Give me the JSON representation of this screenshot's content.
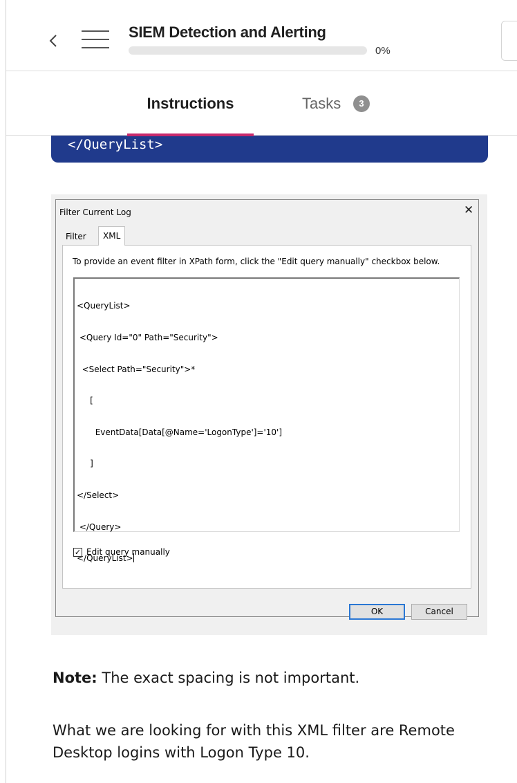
{
  "header": {
    "title": "SIEM Detection and Alerting",
    "progress_percent": 0,
    "progress_label": "0%",
    "accent_color": "#c7296c"
  },
  "tabs": {
    "instructions_label": "Instructions",
    "tasks_label": "Tasks",
    "tasks_count": "3"
  },
  "code_block": {
    "visible_line": "</QueryList>",
    "background": "#203a8c"
  },
  "dialog": {
    "title": "Filter Current Log",
    "close_glyph": "✕",
    "tab_filter": "Filter",
    "tab_xml": "XML",
    "hint": "To provide an event filter in XPath form, click the \"Edit query manually\" checkbox below.",
    "xml_lines": [
      "<QueryList>",
      " <Query Id=\"0\" Path=\"Security\">",
      "  <Select Path=\"Security\">*",
      "     [",
      "       EventData[Data[@Name='LogonType']='10']",
      "     ]",
      "</Select>",
      " </Query>",
      "</QueryList>"
    ],
    "checkbox_label": "Edit query manually",
    "checkbox_checked": true,
    "ok_label": "OK",
    "cancel_label": "Cancel"
  },
  "note": {
    "bold": "Note:",
    "text": " The exact spacing is not important."
  },
  "paragraph": "What we are looking for with this XML filter are Remote Desktop logins with Logon Type 10."
}
